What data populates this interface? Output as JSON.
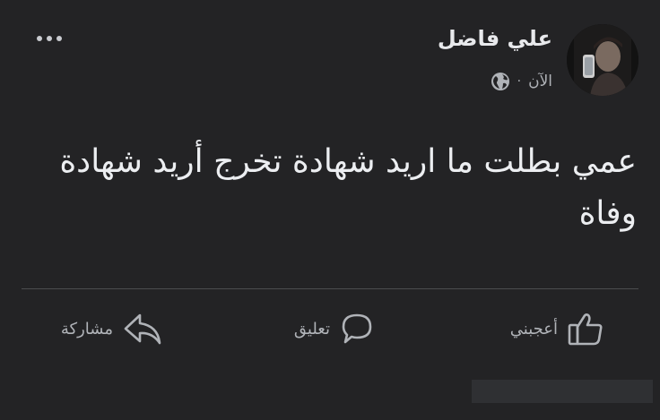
{
  "post": {
    "author_name": "علي فاضل",
    "timestamp": "الآن",
    "separator": "·",
    "privacy_icon": "globe-icon",
    "more_icon": "more-horizontal-icon",
    "text": "عمي بطلت ما اريد شهادة تخرج أريد شهادة وفاة"
  },
  "actions": {
    "like_label": "أعجبني",
    "like_icon": "thumbs-up-icon",
    "comment_label": "تعليق",
    "comment_icon": "comment-bubble-icon",
    "share_label": "مشاركة",
    "share_icon": "share-arrow-icon"
  },
  "colors": {
    "background": "#232325",
    "primary_text": "#e4e6eb",
    "secondary_text": "#b0b3b8",
    "divider": "#4b4c4f"
  }
}
